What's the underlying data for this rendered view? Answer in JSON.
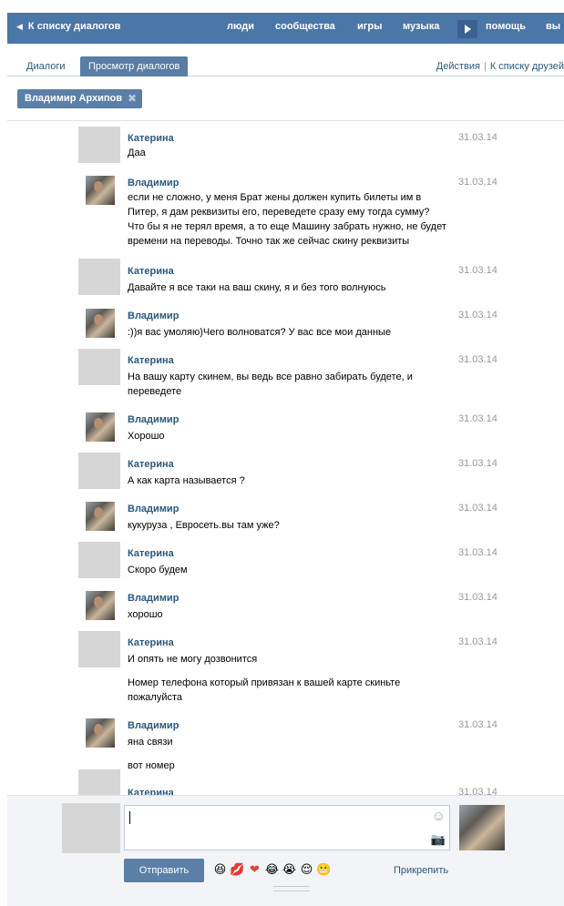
{
  "topbar": {
    "back_label": "К списку диалогов",
    "nav": [
      "люди",
      "сообщества",
      "игры",
      "музыка",
      "помощь",
      "вы"
    ]
  },
  "tabs": [
    "Диалоги",
    "Просмотр диалогов"
  ],
  "actions": {
    "actions_label": "Действия",
    "friends_link": "К списку друзей"
  },
  "chip": {
    "label": "Владимир Архипов",
    "close": "✖"
  },
  "messages": [
    {
      "name": "Катерина",
      "text": "Даа",
      "date": "31.03.14"
    },
    {
      "name": "Владимир",
      "text": "если не сложно, у меня Брат жены должен купить билеты им в Питер, я дам реквизиты его, переведете сразу ему тогда сумму? Что бы я не терял время, а то еще Машину забрать нужно, не будет времени на переводы. Точно так же сейчас скину реквизиты",
      "date": "31.03.14"
    },
    {
      "name": "Катерина",
      "text": "Давайте я все таки на ваш скину, я и без того волнуюсь",
      "date": "31.03.14"
    },
    {
      "name": "Владимир",
      "text": ":))я вас умоляю)Чего волноватся? У вас все мои данные",
      "date": "31.03.14"
    },
    {
      "name": "Катерина",
      "text": "На вашу карту скинем, вы ведь все равно забирать будете, и переведете",
      "date": "31.03.14"
    },
    {
      "name": "Владимир",
      "text": "Хорошо",
      "date": "31.03.14"
    },
    {
      "name": "Катерина",
      "text": "А как карта называется ?",
      "date": "31.03.14"
    },
    {
      "name": "Владимир",
      "text": "кукуруза , Евросеть.вы там уже?",
      "date": "31.03.14"
    },
    {
      "name": "Катерина",
      "text": "Скоро будем",
      "date": "31.03.14"
    },
    {
      "name": "Владимир",
      "text": "хорошо",
      "date": "31.03.14"
    },
    {
      "name": "Катерина",
      "text": "И опять не могу дозвонится",
      "extra": "Номер телефона который привязан к вашей карте скиньте пожалуйста",
      "date": "31.03.14"
    },
    {
      "name": "Владимир",
      "text": "яна связи",
      "extra": "вот номер",
      "date": "31.03.14"
    },
    {
      "name": "Катерина",
      "text": "",
      "date": "31.03.14"
    }
  ],
  "compose": {
    "send_label": "Отправить",
    "attach_label": "Прикрепить",
    "emojis": [
      "😆",
      "💋",
      "❤",
      "😂",
      "😭",
      "😌",
      "😬"
    ]
  }
}
